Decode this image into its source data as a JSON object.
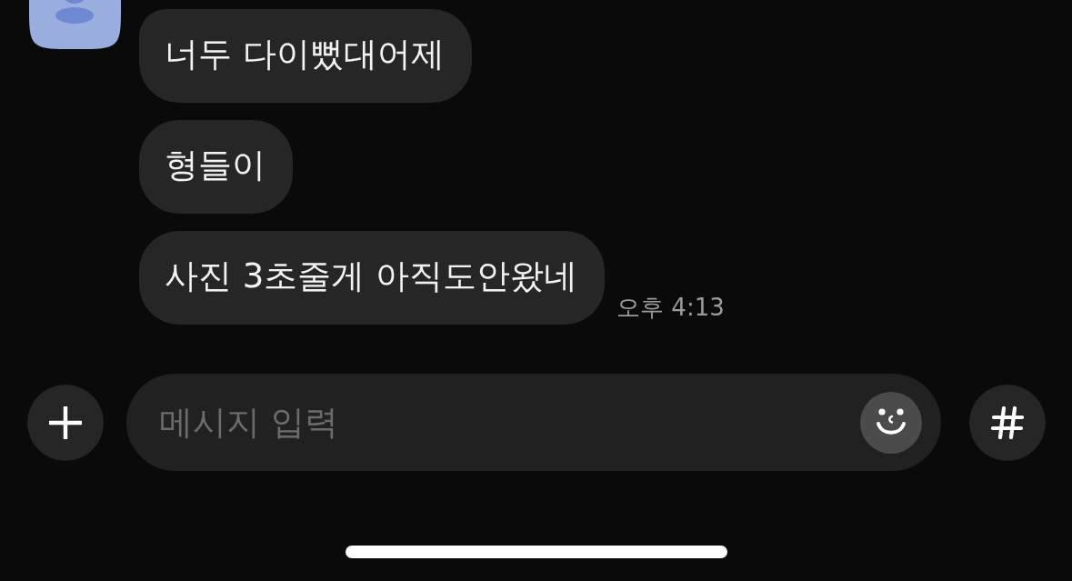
{
  "conversation": {
    "messages": [
      {
        "text": "너두 다이뻤대어제"
      },
      {
        "text": "형들이"
      },
      {
        "text": "사진 3초줄게 아직도안왔네"
      }
    ],
    "timestamp": "오후 4:13"
  },
  "composer": {
    "placeholder": "메시지 입력"
  }
}
